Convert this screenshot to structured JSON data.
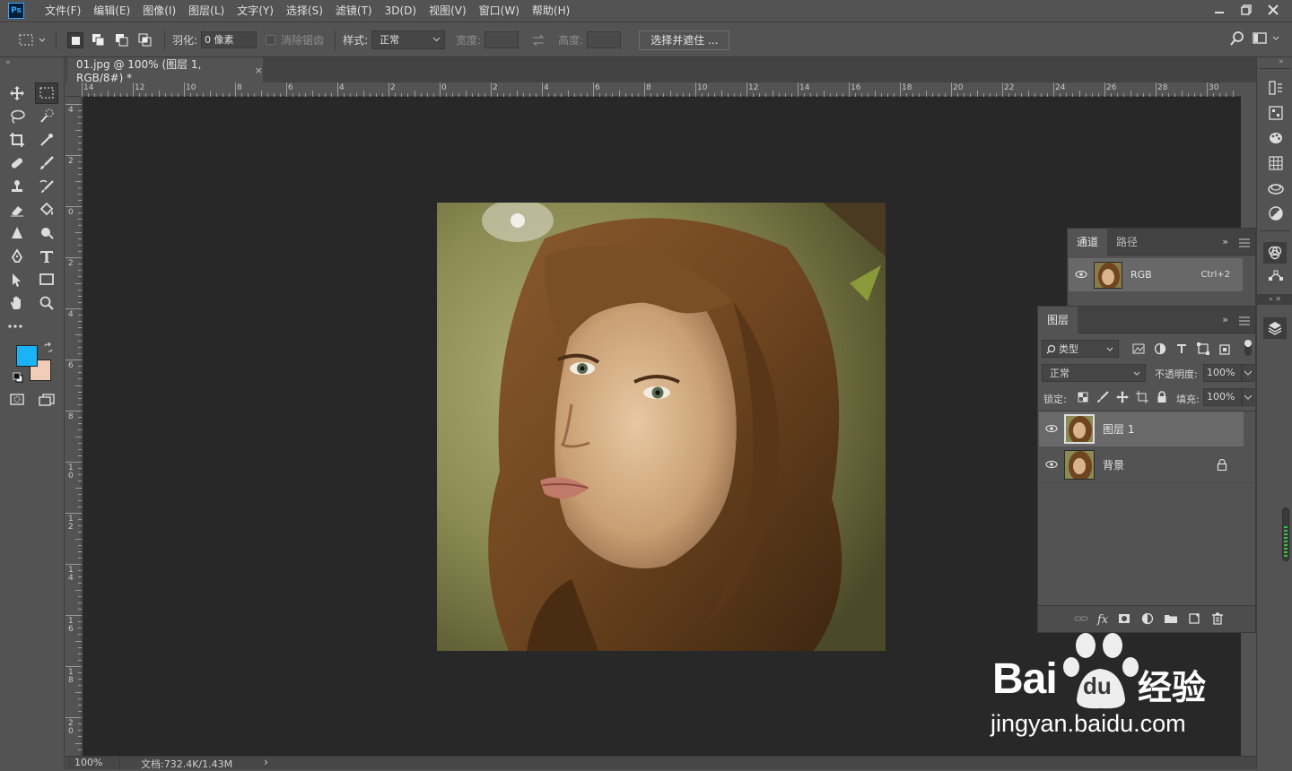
{
  "app": {
    "logo": "Ps",
    "menu": [
      "文件(F)",
      "编辑(E)",
      "图像(I)",
      "图层(L)",
      "文字(Y)",
      "选择(S)",
      "滤镜(T)",
      "3D(D)",
      "视图(V)",
      "窗口(W)",
      "帮助(H)"
    ],
    "window_controls": [
      "minimize-icon",
      "restore-icon",
      "close-icon"
    ]
  },
  "options": {
    "feather_label": "羽化:",
    "feather_value": "0 像素",
    "antialias_label": "消除锯齿",
    "style_label": "样式:",
    "style_value": "正常",
    "width_label": "宽度:",
    "height_label": "高度:",
    "select_mask_button": "选择并遮住 ..."
  },
  "document": {
    "tab_title": "01.jpg @ 100% (图层 1, RGB/8#) *",
    "close": "×"
  },
  "rulers": {
    "top_labels": [
      "14",
      "12",
      "10",
      "8",
      "6",
      "4",
      "2",
      "0",
      "2",
      "4",
      "6",
      "8",
      "10",
      "12",
      "14",
      "16",
      "18",
      "20",
      "22",
      "24",
      "26",
      "28",
      "30"
    ],
    "left_labels": [
      "4",
      "2",
      "0",
      "2",
      "4",
      "6",
      "8",
      "1 0",
      "1 2",
      "1 4",
      "1 6",
      "1 8",
      "2 0"
    ]
  },
  "status": {
    "zoom": "100%",
    "doc_info": "文档:732.4K/1.43M",
    "arrow": "›"
  },
  "channels_panel": {
    "tabs": [
      "通道",
      "路径"
    ],
    "rows": [
      {
        "name": "RGB",
        "shortcut": "Ctrl+2"
      }
    ]
  },
  "layers_panel": {
    "tab": "图层",
    "filter_kind": "类型",
    "blend_mode": "正常",
    "opacity_label": "不透明度:",
    "opacity_value": "100%",
    "lock_label": "锁定:",
    "fill_label": "填充:",
    "fill_value": "100%",
    "layers": [
      {
        "name": "图层 1",
        "selected": true,
        "locked": false
      },
      {
        "name": "背景",
        "selected": false,
        "locked": true
      }
    ],
    "footer_fx": "fx"
  },
  "colors": {
    "foreground": "#1ab3f5",
    "background": "#efcdb7",
    "canvas": "#282828",
    "ui": "#535353"
  },
  "watermark": {
    "logo_text": "Bai",
    "logo_text2": "经验",
    "url": "jingyan.baidu.com"
  }
}
